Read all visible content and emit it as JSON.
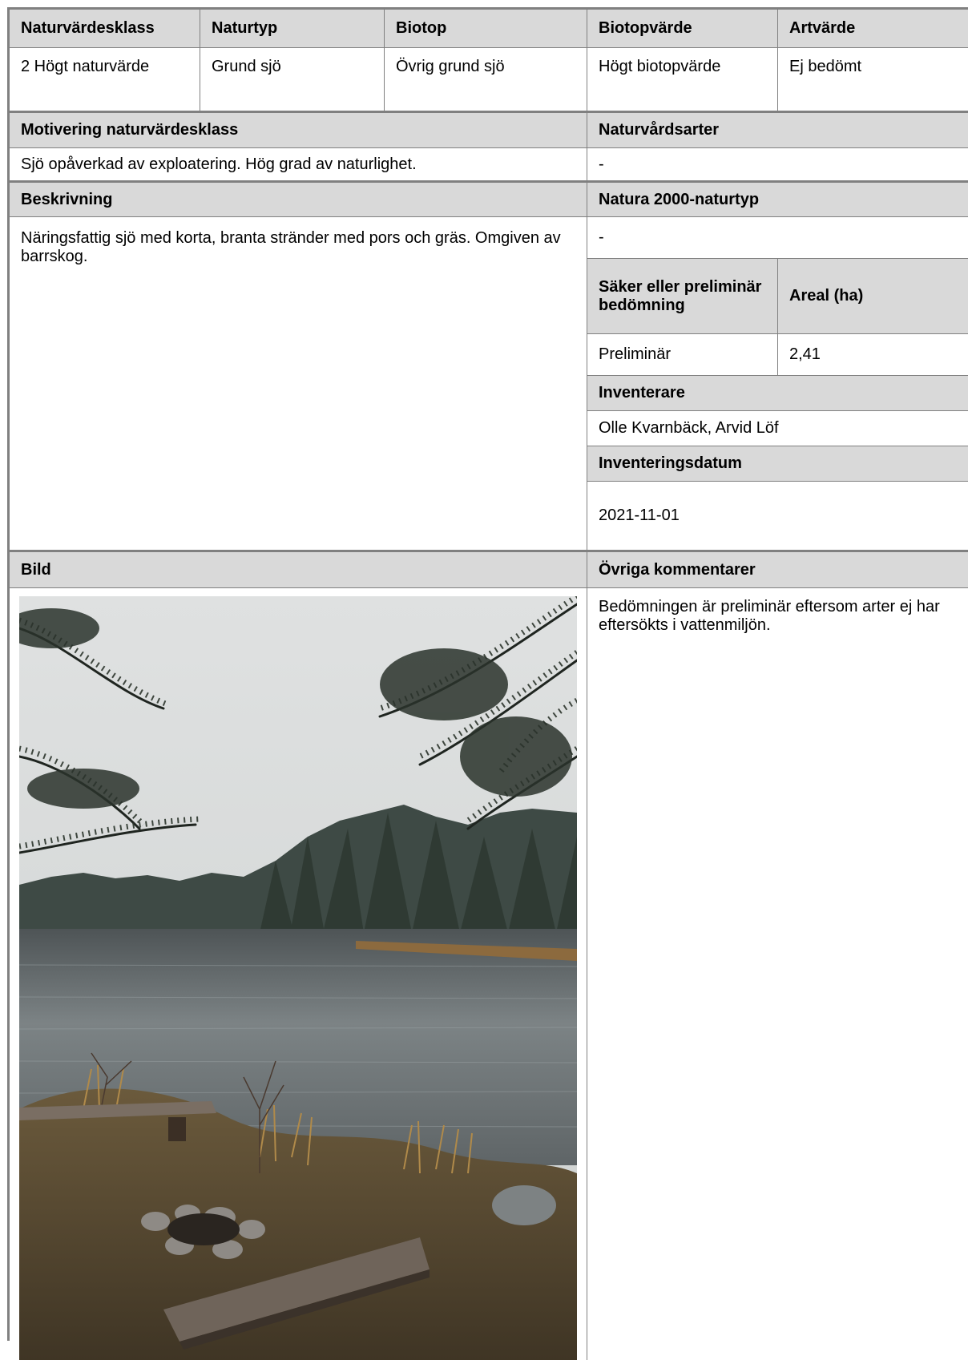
{
  "header": {
    "naturvardesklass": "Naturvärdesklass",
    "naturtyp": "Naturtyp",
    "biotop": "Biotop",
    "biotopvarde": "Biotopvärde",
    "artvarde": "Artvärde"
  },
  "values": {
    "naturvardesklass": "2 Högt naturvärde",
    "naturtyp": "Grund sjö",
    "biotop": "Övrig grund sjö",
    "biotopvarde": "Högt biotopvärde",
    "artvarde": "Ej bedömt"
  },
  "motivering": {
    "label": "Motivering naturvärdesklass",
    "text": "Sjö opåverkad av exploatering. Hög grad av naturlighet."
  },
  "naturvardsarter": {
    "label": "Naturvårdsarter",
    "value": "-"
  },
  "beskrivning": {
    "label": "Beskrivning",
    "text": "Näringsfattig sjö med korta, branta stränder med pors och gräs. Omgiven av barrskog."
  },
  "natura2000": {
    "label": "Natura 2000-naturtyp",
    "value": "-"
  },
  "bedomning": {
    "label": "Säker eller preliminär bedömning",
    "value": "Preliminär"
  },
  "areal": {
    "label": "Areal (ha)",
    "value": "2,41"
  },
  "inventerare": {
    "label": "Inventerare",
    "value": "Olle Kvarnbäck, Arvid Löf"
  },
  "inventeringsdatum": {
    "label": "Inventeringsdatum",
    "value": "2021-11-01"
  },
  "bild": {
    "label": "Bild"
  },
  "kommentarer": {
    "label": "Övriga kommentarer",
    "text": "Bedömningen är preliminär eftersom arter ej har eftersökts i vattenmiljön."
  }
}
